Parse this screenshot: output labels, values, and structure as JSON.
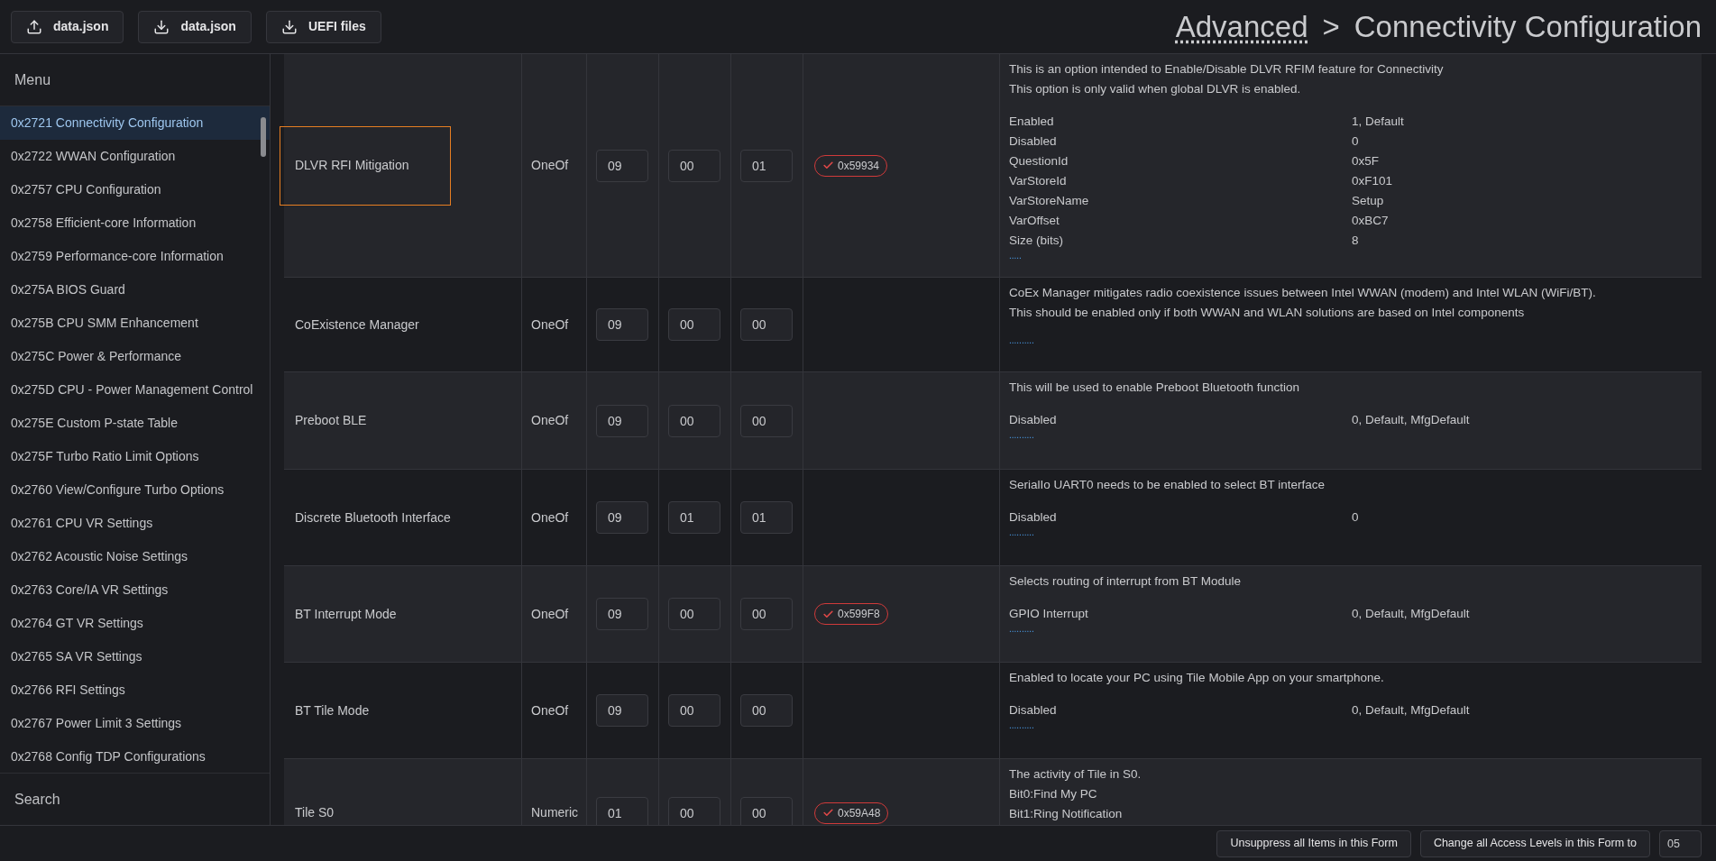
{
  "toolbar": {
    "buttons": [
      {
        "kind": "upload",
        "label": "data.json"
      },
      {
        "kind": "download",
        "label": "data.json"
      },
      {
        "kind": "download",
        "label": "UEFI files"
      }
    ]
  },
  "breadcrumb": {
    "parent": "Advanced",
    "separator": ">",
    "current": "Connectivity Configuration"
  },
  "sidebar": {
    "title": "Menu",
    "search": "Search",
    "items": [
      {
        "label": "0x2721 Connectivity Configuration",
        "selected": true
      },
      {
        "label": "0x2722 WWAN Configuration",
        "selected": false
      },
      {
        "label": "0x2757 CPU Configuration",
        "selected": false
      },
      {
        "label": "0x2758 Efficient-core Information",
        "selected": false
      },
      {
        "label": "0x2759 Performance-core Information",
        "selected": false
      },
      {
        "label": "0x275A BIOS Guard",
        "selected": false
      },
      {
        "label": "0x275B CPU SMM Enhancement",
        "selected": false
      },
      {
        "label": "0x275C Power & Performance",
        "selected": false
      },
      {
        "label": "0x275D CPU - Power Management Control",
        "selected": false
      },
      {
        "label": "0x275E Custom P-state Table",
        "selected": false
      },
      {
        "label": "0x275F Turbo Ratio Limit Options",
        "selected": false
      },
      {
        "label": "0x2760 View/Configure Turbo Options",
        "selected": false
      },
      {
        "label": "0x2761 CPU VR Settings",
        "selected": false
      },
      {
        "label": "0x2762 Acoustic Noise Settings",
        "selected": false
      },
      {
        "label": "0x2763 Core/IA VR Settings",
        "selected": false
      },
      {
        "label": "0x2764 GT VR Settings",
        "selected": false
      },
      {
        "label": "0x2765 SA VR Settings",
        "selected": false
      },
      {
        "label": "0x2766 RFI Settings",
        "selected": false
      },
      {
        "label": "0x2767 Power Limit 3 Settings",
        "selected": false
      },
      {
        "label": "0x2768 Config TDP Configurations",
        "selected": false
      }
    ]
  },
  "table": {
    "rows": [
      {
        "name": "DLVR RFI Mitigation",
        "selected": true,
        "type": "OneOf",
        "values": [
          "09",
          "00",
          "01"
        ],
        "badge": "0x59934",
        "description": [
          "This is an option intended to Enable/Disable DLVR RFIM feature for Connectivity",
          "This option is only valid when global DLVR is enabled."
        ],
        "options": [
          [
            "Enabled",
            "1, Default"
          ],
          [
            "Disabled",
            "0"
          ],
          [
            "QuestionId",
            "0x5F"
          ],
          [
            "VarStoreId",
            "0xF101"
          ],
          [
            "VarStoreName",
            "Setup"
          ],
          [
            "VarOffset",
            "0xBC7"
          ],
          [
            "Size (bits)",
            "8"
          ]
        ],
        "more": "....."
      },
      {
        "name": "CoExistence Manager",
        "selected": false,
        "type": "OneOf",
        "values": [
          "09",
          "00",
          "00"
        ],
        "description": [
          "CoEx Manager mitigates radio coexistence issues between Intel WWAN (modem) and Intel WLAN (WiFi/BT).",
          "This should be enabled only if both WWAN and WLAN solutions are based on Intel components"
        ],
        "options": [],
        "more": ".........."
      },
      {
        "name": "Preboot BLE",
        "selected": false,
        "type": "OneOf",
        "values": [
          "09",
          "00",
          "00"
        ],
        "description": [
          "This will be used to enable Preboot Bluetooth function"
        ],
        "options": [
          [
            "Disabled",
            "0, Default, MfgDefault"
          ]
        ],
        "more": ".........."
      },
      {
        "name": "Discrete Bluetooth Interface",
        "selected": false,
        "type": "OneOf",
        "values": [
          "09",
          "01",
          "01"
        ],
        "description": [
          "SerialIo UART0 needs to be enabled to select BT interface"
        ],
        "options": [
          [
            "Disabled",
            "0"
          ]
        ],
        "more": ".........."
      },
      {
        "name": "BT Interrupt Mode",
        "selected": false,
        "type": "OneOf",
        "values": [
          "09",
          "00",
          "00"
        ],
        "badge": "0x599F8",
        "description": [
          "Selects routing of interrupt from BT Module"
        ],
        "options": [
          [
            "GPIO Interrupt",
            "0, Default, MfgDefault"
          ]
        ],
        "more": ".........."
      },
      {
        "name": "BT Tile Mode",
        "selected": false,
        "type": "OneOf",
        "values": [
          "09",
          "00",
          "00"
        ],
        "description": [
          "Enabled to locate your PC using Tile Mobile App on your smartphone."
        ],
        "options": [
          [
            "Disabled",
            "0, Default, MfgDefault"
          ]
        ],
        "more": ".........."
      },
      {
        "name": "Tile S0",
        "selected": false,
        "type": "Numeric",
        "values": [
          "01",
          "00",
          "00"
        ],
        "badge": "0x59A48",
        "description": [
          "The activity of Tile in S0.",
          "Bit0:Find My PC",
          "Bit1:Ring Notification"
        ],
        "options": []
      }
    ]
  },
  "footer": {
    "buttons": [
      "Unsuppress all Items in this Form",
      "Change all Access Levels in this Form to"
    ],
    "access_level": "05"
  }
}
